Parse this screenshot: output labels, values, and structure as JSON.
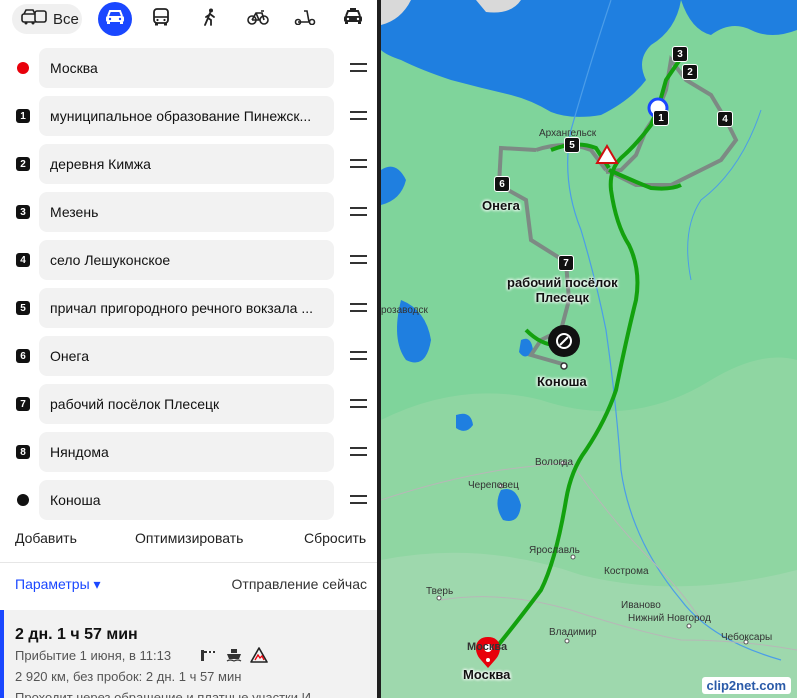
{
  "modes": {
    "all_label": "Все",
    "items": [
      "car-icon",
      "bus-icon",
      "walk-icon",
      "bike-icon",
      "scooter-icon",
      "taxi-icon"
    ],
    "active": "car-icon"
  },
  "colors": {
    "accent": "#1a47ff",
    "route": "#13a10e",
    "alt_route": "#7d8a84",
    "start": "#e8000b"
  },
  "waypoints": [
    {
      "marker": "",
      "type": "start",
      "label": "Москва"
    },
    {
      "marker": "1",
      "type": "via",
      "label": "муниципальное образование Пинежск..."
    },
    {
      "marker": "2",
      "type": "via",
      "label": "деревня Кимжа"
    },
    {
      "marker": "3",
      "type": "via",
      "label": "Мезень"
    },
    {
      "marker": "4",
      "type": "via",
      "label": "село Лешуконское"
    },
    {
      "marker": "5",
      "type": "via",
      "label": "причал пригородного речного вокзала ..."
    },
    {
      "marker": "6",
      "type": "via",
      "label": "Онега"
    },
    {
      "marker": "7",
      "type": "via",
      "label": "рабочий посёлок Плесецк"
    },
    {
      "marker": "8",
      "type": "via",
      "label": "Няндома"
    },
    {
      "marker": "",
      "type": "end",
      "label": "Коноша"
    }
  ],
  "actions": {
    "add": "Добавить",
    "optimize": "Оптимизировать",
    "reset": "Сбросить"
  },
  "params": {
    "label": "Параметры ▾",
    "departure": "Отправление сейчас"
  },
  "summary": {
    "duration": "2 дн. 1 ч 57 мин",
    "arrival": "Прибытие 1 июня, в 11:13",
    "distance": "2 920 км, без пробок: 2 дн. 1 ч 57 мин",
    "more": "Проходит через обращение и платные участки И"
  },
  "map": {
    "labels": {
      "arkhangelsk": "Архангельск",
      "onega": "Онега",
      "plesetsk": "рабочий посёлок\nПлесецк",
      "konosha": "Коноша",
      "petrozavodsk": "розаводск",
      "vologda": "Вологда",
      "cherepovets": "Череповец",
      "yaroslavl": "Ярославль",
      "tver": "Тверь",
      "moscow_small": "Москва",
      "moscow": "Москва",
      "vladimir": "Владимир",
      "nizhny": "Нижний Новгород",
      "cheboksary": "Чебоксары",
      "ivanovo": "Иваново",
      "kostroma": "Кострома"
    },
    "pins": [
      "1",
      "2",
      "3",
      "4",
      "5",
      "6",
      "7"
    ],
    "watermark": "clip2net.com"
  }
}
